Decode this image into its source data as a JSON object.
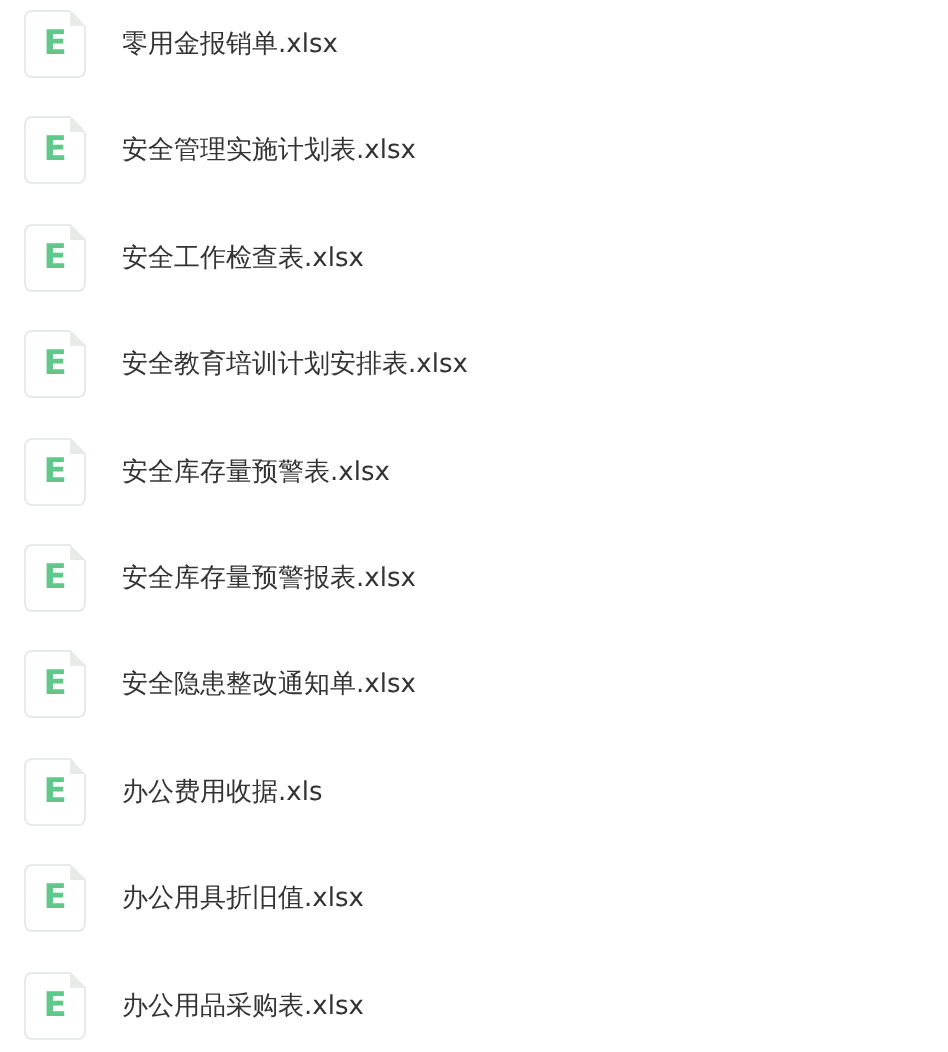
{
  "files": [
    {
      "badge": "E",
      "name": "零用金报销单.xlsx"
    },
    {
      "badge": "E",
      "name": "安全管理实施计划表.xlsx"
    },
    {
      "badge": "E",
      "name": "安全工作检查表.xlsx"
    },
    {
      "badge": "E",
      "name": "安全教育培训计划安排表.xlsx"
    },
    {
      "badge": "E",
      "name": "安全库存量预警表.xlsx"
    },
    {
      "badge": "E",
      "name": "安全库存量预警报表.xlsx"
    },
    {
      "badge": "E",
      "name": "安全隐患整改通知单.xlsx"
    },
    {
      "badge": "E",
      "name": "办公费用收据.xls"
    },
    {
      "badge": "E",
      "name": "办公用具折旧值.xlsx"
    },
    {
      "badge": "E",
      "name": "办公用品采购表.xlsx"
    }
  ]
}
